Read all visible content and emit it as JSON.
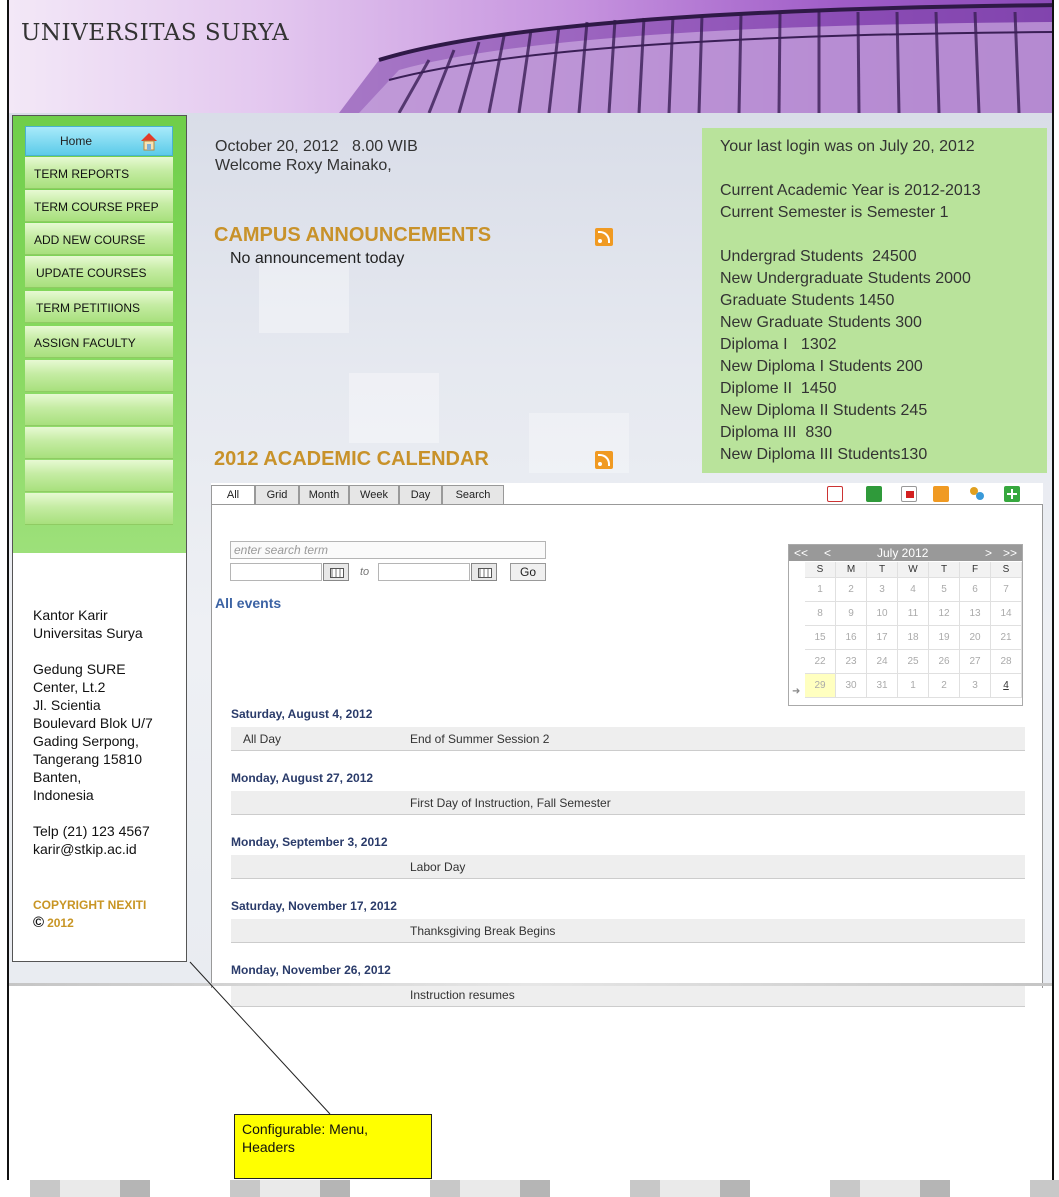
{
  "header": {
    "site_title": "UNIVERSITAS SURYA"
  },
  "menu": {
    "home_label": "Home",
    "items": [
      {
        "label": "TERM REPORTS"
      },
      {
        "label": "TERM COURSE PREP"
      },
      {
        "label": "ADD NEW COURSE"
      },
      {
        "label": "UPDATE COURSES"
      },
      {
        "label": "TERM PETITIIONS"
      },
      {
        "label": "ASSIGN FACULTY"
      }
    ]
  },
  "contact": {
    "line1": "Kantor Karir",
    "line2": "Universitas Surya",
    "addr1": "Gedung SURE",
    "addr2": "Center, Lt.2",
    "addr3": "Jl. Scientia",
    "addr4": "Boulevard Blok U/7",
    "addr5": "Gading Serpong,",
    "addr6": "Tangerang 15810",
    "addr7": "Banten,",
    "addr8": "Indonesia",
    "phone": "Telp (21) 123 4567",
    "email": "karir@stkip.ac.id"
  },
  "copyright": {
    "line1": "COPYRIGHT NEXITI",
    "symbol": "©",
    "year": "2012"
  },
  "greeting": {
    "datetime": "October 20, 2012   8.00 WIB",
    "welcome": "Welcome Roxy Mainako,"
  },
  "announcements": {
    "title": "CAMPUS ANNOUNCEMENTS",
    "empty_text": "No announcement today"
  },
  "info": {
    "last_login": "Your last login was on July 20, 2012",
    "academic_year": "Current Academic Year is 2012-2013",
    "semester": "Current Semester is Semester 1",
    "stats": [
      "Undergrad Students  24500",
      "New Undergraduate Students 2000",
      "Graduate Students 1450",
      "New Graduate Students 300",
      "Diploma I   1302",
      "New Diploma I Students 200",
      "Diplome II  1450",
      "New Diploma II Students 245",
      "Diploma III  830",
      "New Diploma III Students130"
    ]
  },
  "calendar": {
    "title": "2012 ACADEMIC CALENDAR",
    "tabs": [
      "All",
      "Grid",
      "Month",
      "Week",
      "Day",
      "Search"
    ],
    "search_placeholder": "enter search term",
    "to_label": "to",
    "go_label": "Go",
    "all_events_label": "All events",
    "mini": {
      "prev_year": "<<",
      "prev_month": "<",
      "month_label": "July 2012",
      "next_month": ">",
      "next_year": ">>",
      "dow": [
        "S",
        "M",
        "T",
        "W",
        "T",
        "F",
        "S"
      ],
      "weeks": [
        [
          "1",
          "2",
          "3",
          "4",
          "5",
          "6",
          "7"
        ],
        [
          "8",
          "9",
          "10",
          "11",
          "12",
          "13",
          "14"
        ],
        [
          "15",
          "16",
          "17",
          "18",
          "19",
          "20",
          "21"
        ],
        [
          "22",
          "23",
          "24",
          "25",
          "26",
          "27",
          "28"
        ],
        [
          "29",
          "30",
          "31",
          "1",
          "2",
          "3",
          "4"
        ]
      ]
    },
    "agenda": [
      {
        "date": "Saturday, August 4, 2012",
        "time": "All Day",
        "event": "End of Summer Session 2"
      },
      {
        "date": "Monday, August 27, 2012",
        "time": "",
        "event": "First Day of Instruction, Fall Semester"
      },
      {
        "date": "Monday, September 3, 2012",
        "time": "",
        "event": "Labor Day"
      },
      {
        "date": "Saturday, November 17, 2012",
        "time": "",
        "event": "Thanksgiving Break Begins"
      },
      {
        "date": "Monday, November 26, 2012",
        "time": "",
        "event": "Instruction resumes"
      }
    ]
  },
  "callout": {
    "text": "Configurable: Menu, Headers"
  },
  "colors": {
    "menu_green": "#86d85e",
    "accent_gold": "#c8922a",
    "info_green": "#b9e39b",
    "callout_yellow": "#ffff00"
  }
}
